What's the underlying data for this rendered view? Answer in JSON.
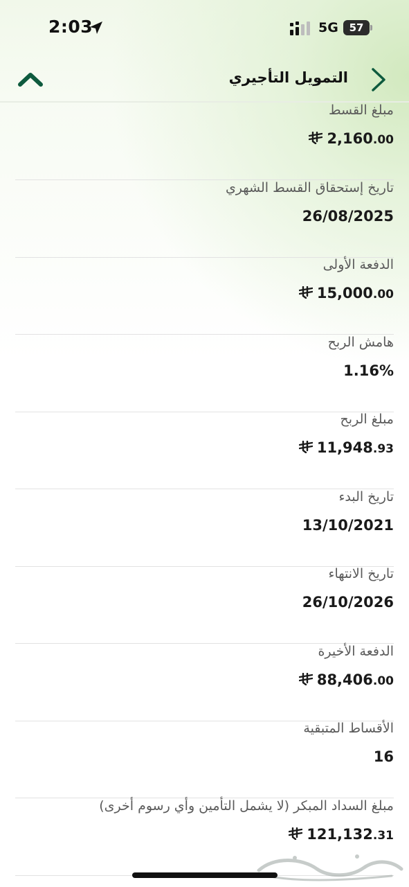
{
  "status_bar": {
    "time": "2:03",
    "network": "5G",
    "battery": "57"
  },
  "header": {
    "title": "التمويل التأجيري"
  },
  "rows": [
    {
      "label": "مبلغ القسط",
      "int": "2,160",
      "dec": ".00",
      "currency": true
    },
    {
      "label": "تاريخ إستحقاق القسط الشهري",
      "text": "26/08/2025"
    },
    {
      "label": "الدفعة الأولى",
      "int": "15,000",
      "dec": ".00",
      "currency": true
    },
    {
      "label": "هامش الربح",
      "text": "1.16%"
    },
    {
      "label": "مبلغ الربح",
      "int": "11,948",
      "dec": ".93",
      "currency": true
    },
    {
      "label": "تاريخ البدء",
      "text": "13/10/2021"
    },
    {
      "label": "تاريخ الانتهاء",
      "text": "26/10/2026"
    },
    {
      "label": "الدفعة الأخيرة",
      "int": "88,406",
      "dec": ".00",
      "currency": true
    },
    {
      "label": "الأقساط المتبقية",
      "text": "16"
    },
    {
      "label": "مبلغ السداد المبكر (لا يشمل التأمين وأي رسوم أخرى)",
      "int": "121,132",
      "dec": ".31",
      "currency": true
    }
  ],
  "icons": {
    "collapse": "chevron-up-icon",
    "back": "chevron-right-icon",
    "currency": "saudi-riyal-icon",
    "location": "location-arrow-icon",
    "signal": "cellular-signal-icon",
    "watermark": "haraj-watermark-logo"
  },
  "colors": {
    "accent": "#0e5a3e",
    "gradient": "#d3eac0",
    "text": "#1a1a1a",
    "label": "#5a5a5a",
    "divider": "#e2e2e2"
  },
  "watermark_text": "حراج"
}
